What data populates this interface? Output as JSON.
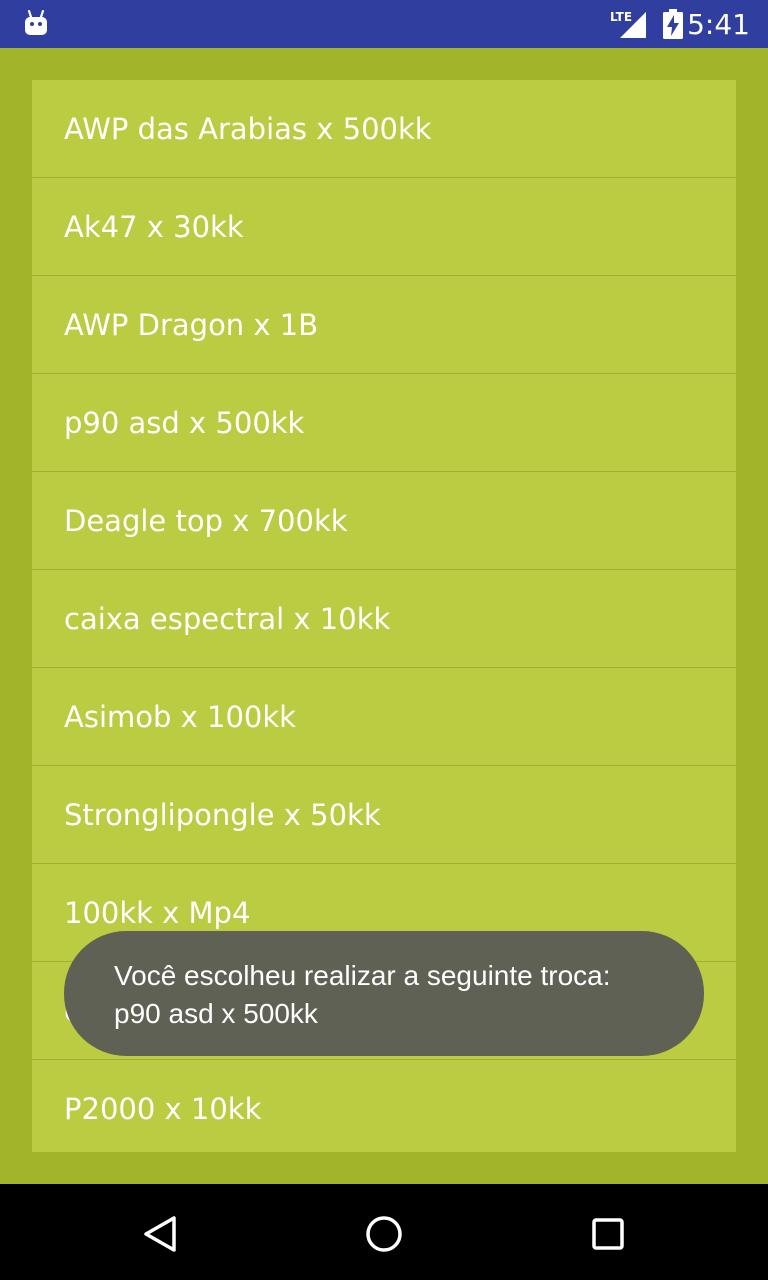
{
  "status_bar": {
    "notification_icon": "android-icon",
    "network_label": "LTE",
    "signal_icon": "signal-icon",
    "battery_icon": "battery-charging-icon",
    "time": "5:41"
  },
  "list": {
    "items": [
      {
        "label": "AWP das Arabias x 500kk"
      },
      {
        "label": "Ak47 x 30kk"
      },
      {
        "label": "AWP Dragon x 1B"
      },
      {
        "label": "p90 asd x 500kk"
      },
      {
        "label": "Deagle top x 700kk"
      },
      {
        "label": "caixa espectral x 10kk"
      },
      {
        "label": "Asimob x 100kk"
      },
      {
        "label": "Stronglipongle x 50kk"
      },
      {
        "label": "100kk x Mp4"
      },
      {
        "label": "etc"
      },
      {
        "label": "P2000 x 10kk"
      }
    ]
  },
  "toast": {
    "line1": "Você escolheu realizar a seguinte troca:",
    "line2": "p90 asd x 500kk"
  },
  "nav_bar": {
    "back_icon": "back-icon",
    "home_icon": "home-icon",
    "recents_icon": "recents-icon"
  },
  "colors": {
    "status_bar": "#303f9f",
    "background": "#a2b42a",
    "list_card": "#bbcb42",
    "toast": "#5f6154",
    "nav_bar": "#000000"
  }
}
